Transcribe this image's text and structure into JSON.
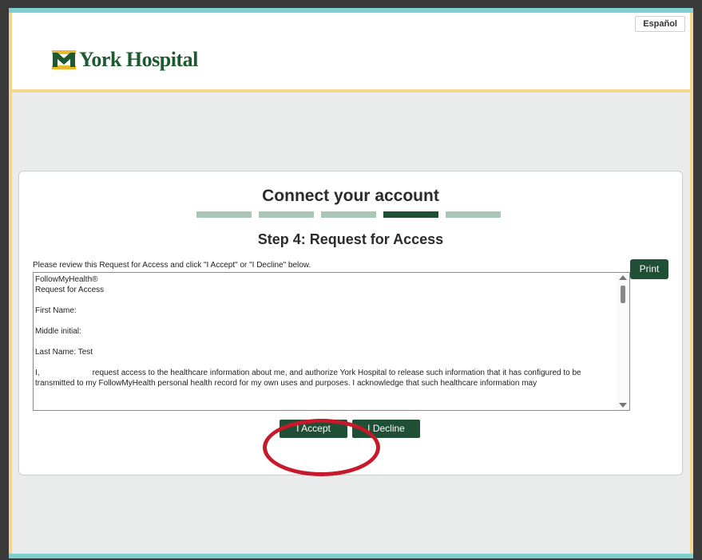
{
  "header": {
    "brand": "York Hospital",
    "language_button": "Español"
  },
  "card": {
    "title": "Connect your account",
    "progress": {
      "total_steps": 5,
      "current_step": 4
    },
    "step_title": "Step 4: Request for Access",
    "instructions": "Please review this Request for Access and click \"I Accept\" or \"I Decline\" below.",
    "print_label": "Print",
    "document": {
      "line1": "FollowMyHealth®",
      "line2": "Request for Access",
      "first_name": "First Name:",
      "middle_initial": "Middle initial:",
      "last_name": "Last Name: Test",
      "body_prefix": "I,",
      "body_text": "request access to the healthcare information about me, and authorize York Hospital to release such information that it has configured to be transmitted to my FollowMyHealth personal health record for my own uses and purposes. I acknowledge that such healthcare information may"
    },
    "accept_label": "I Accept",
    "decline_label": "I Decline"
  },
  "colors": {
    "brand_green": "#1f4f35",
    "progress_inactive": "#a9c6b7",
    "annotation_red": "#c8192b",
    "frame_gold": "#f6d58c",
    "frame_teal": "#7ecfcf"
  }
}
